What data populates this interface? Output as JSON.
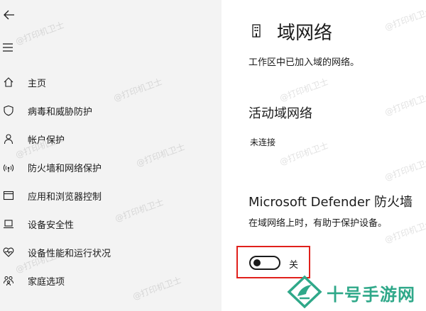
{
  "sidebar": {
    "items": [
      {
        "label": "主页",
        "icon": "home-icon"
      },
      {
        "label": "病毒和威胁防护",
        "icon": "shield-icon"
      },
      {
        "label": "帐户保护",
        "icon": "person-icon"
      },
      {
        "label": "防火墙和网络保护",
        "icon": "wifi-icon"
      },
      {
        "label": "应用和浏览器控制",
        "icon": "browser-window-icon"
      },
      {
        "label": "设备安全性",
        "icon": "laptop-icon"
      },
      {
        "label": "设备性能和运行状况",
        "icon": "heart-pulse-icon"
      },
      {
        "label": "家庭选项",
        "icon": "family-icon"
      }
    ]
  },
  "main": {
    "title": "域网络",
    "title_icon": "building-icon",
    "description": "工作区中已加入域的网络。",
    "active_networks": {
      "heading": "活动域网络",
      "status": "未连接"
    },
    "defender": {
      "heading": "Microsoft Defender 防火墙",
      "description": "在域网络上时，有助于保护设备。",
      "toggle_state": "off",
      "toggle_label": "关"
    }
  },
  "watermark": {
    "text": "@打印机卫士"
  },
  "site_logo": {
    "text": "十号手游网",
    "color": "#2fa889"
  },
  "colors": {
    "sidebar_bg": "#f3f3f3",
    "highlight": "#e0201b"
  }
}
